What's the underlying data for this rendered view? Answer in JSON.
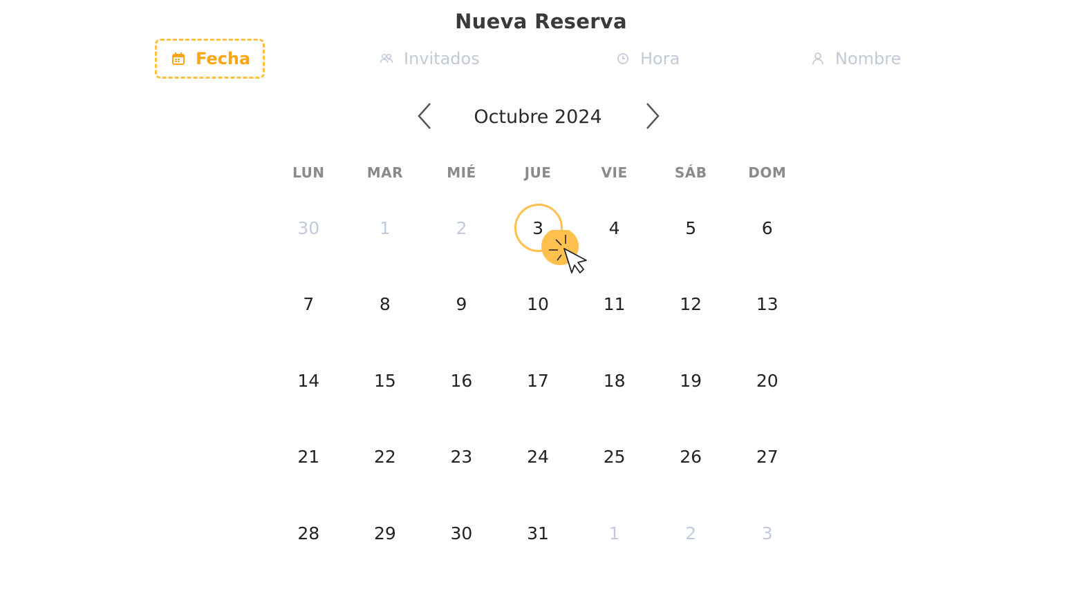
{
  "header": {
    "title": "Nueva Reserva"
  },
  "steps": [
    {
      "label": "Fecha",
      "icon": "calendar-icon",
      "active": true
    },
    {
      "label": "Invitados",
      "icon": "users-icon",
      "active": false
    },
    {
      "label": "Hora",
      "icon": "clock-icon",
      "active": false
    },
    {
      "label": "Nombre",
      "icon": "user-icon",
      "active": false
    }
  ],
  "calendar": {
    "month_label": "Octubre 2024",
    "weekdays": [
      "LUN",
      "MAR",
      "MIÉ",
      "JUE",
      "VIE",
      "SÁB",
      "DOM"
    ],
    "weeks": [
      [
        "30",
        "1",
        "2",
        "3",
        "4",
        "5",
        "6"
      ],
      [
        "7",
        "8",
        "9",
        "10",
        "11",
        "12",
        "13"
      ],
      [
        "14",
        "15",
        "16",
        "17",
        "18",
        "19",
        "20"
      ],
      [
        "21",
        "22",
        "23",
        "24",
        "25",
        "26",
        "27"
      ],
      [
        "28",
        "29",
        "30",
        "31",
        "1",
        "2",
        "3"
      ]
    ],
    "selected_day": "3"
  },
  "colors": {
    "accent": "#ffa412",
    "accent_border": "#ffbf3f",
    "muted": "#c2cbdb",
    "text": "#222222"
  }
}
